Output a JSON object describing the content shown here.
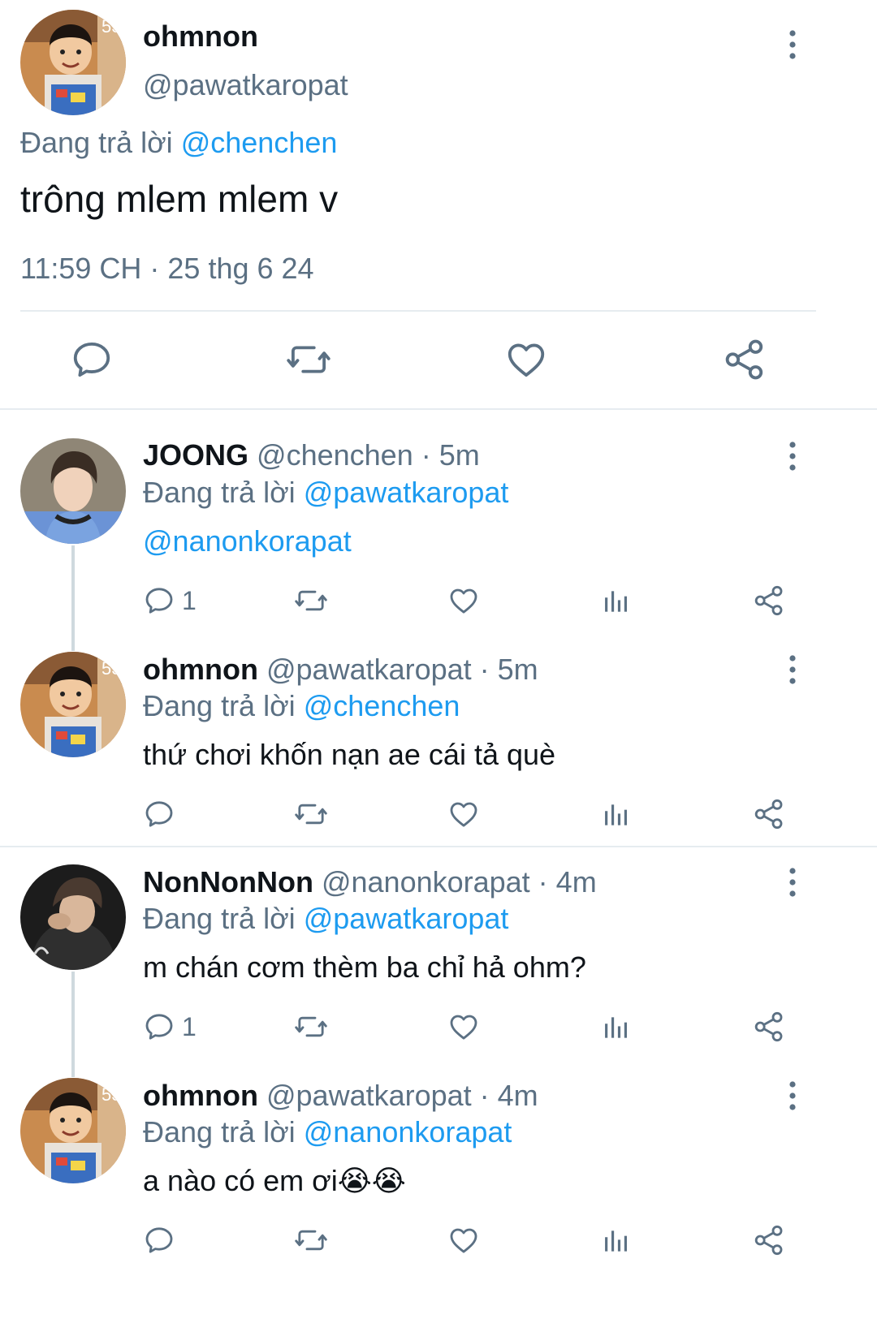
{
  "main_tweet": {
    "display_name": "ohmnon",
    "handle": "@pawatkaropat",
    "reply_prefix": "Đang trả lời",
    "reply_to": "@chenchen",
    "text": "trông mlem mlem v",
    "timestamp": "11:59 CH · 25 thg 6 24"
  },
  "replies": [
    {
      "display_name": "JOONG",
      "handle_time": "@chenchen · 5m",
      "reply_prefix": "Đang trả lời",
      "reply_to": "@pawatkaropat",
      "text": "@nanonkorapat",
      "reply_count": "1"
    },
    {
      "display_name": "ohmnon",
      "handle_time": "@pawatkaropat · 5m",
      "reply_prefix": "Đang trả lời",
      "reply_to": "@chenchen",
      "text": "thứ chơi khốn nạn ae cái tả què",
      "reply_count": ""
    },
    {
      "display_name": "NonNonNon",
      "handle_time": "@nanonkorapat · 4m",
      "reply_prefix": "Đang trả lời",
      "reply_to": "@pawatkaropat",
      "text": "m chán cơm thèm ba chỉ hả ohm?",
      "reply_count": "1"
    },
    {
      "display_name": "ohmnon",
      "handle_time": "@pawatkaropat · 4m",
      "reply_prefix": "Đang trả lời",
      "reply_to": "@nanonkorapat",
      "text": "a nào có em ơi😭😭",
      "reply_count": ""
    }
  ],
  "icons": {
    "reply": "speech-bubble-icon",
    "retweet": "retweet-icon",
    "like": "heart-icon",
    "views": "bar-chart-icon",
    "share": "share-icon",
    "more": "vertical-dots-icon"
  },
  "colors": {
    "link": "#1d9bf0",
    "secondary_text": "#5b7083",
    "primary_text": "#0f1419",
    "divider": "#e6ecf0"
  }
}
